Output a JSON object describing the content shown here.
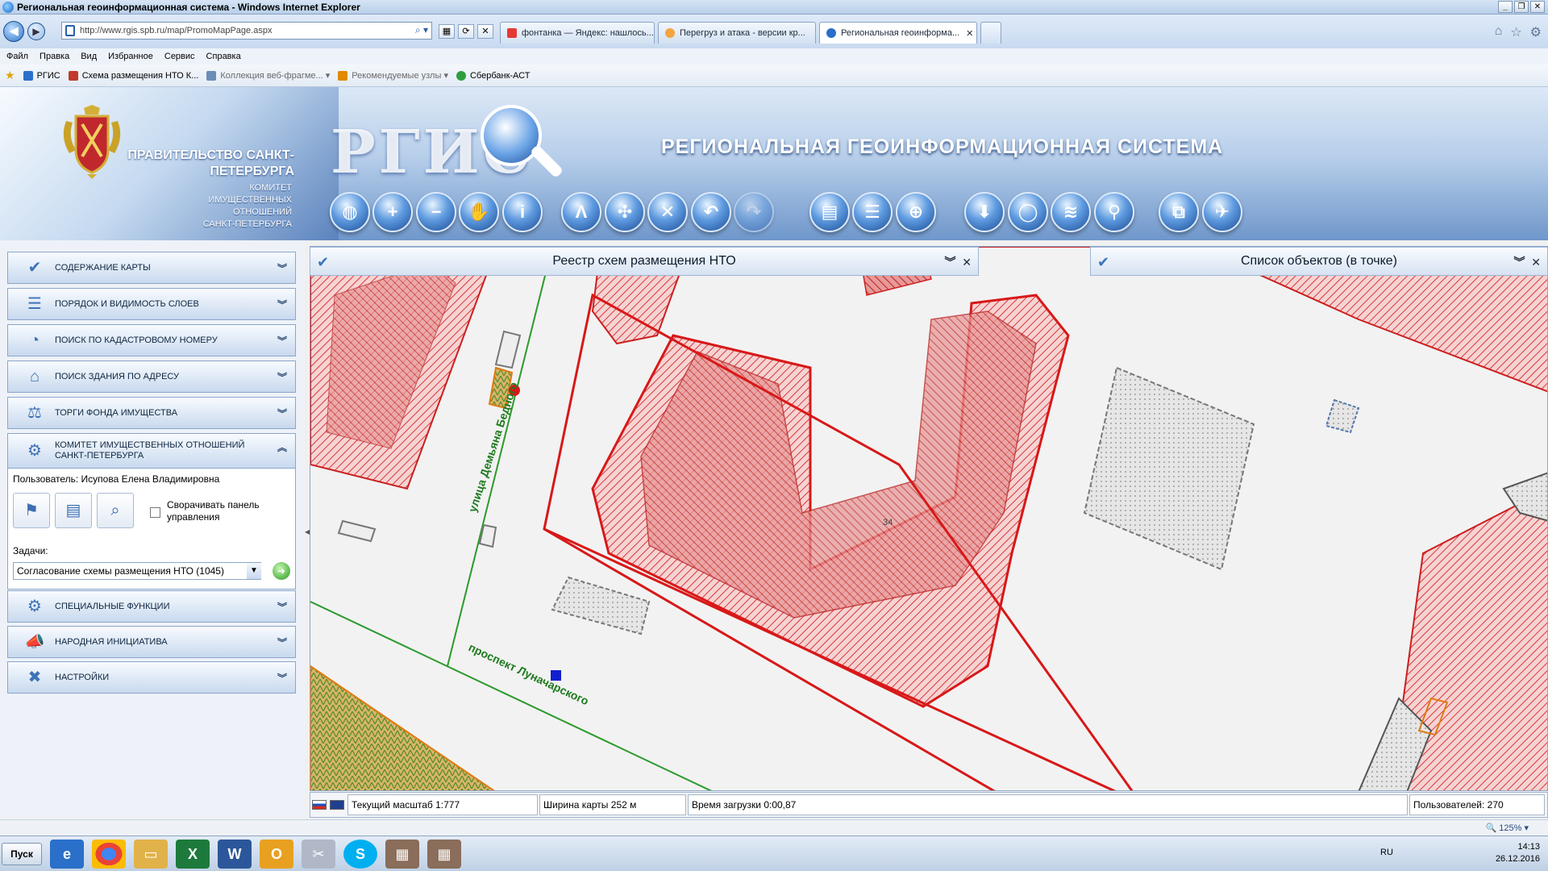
{
  "window": {
    "title": "Региональная геоинформационная система - Windows Internet Explorer"
  },
  "browser": {
    "address": "http://www.rgis.spb.ru/map/PromoMapPage.aspx",
    "tabs": [
      {
        "label": "фонтанка — Яндекс: нашлось..."
      },
      {
        "label": "Перегруз и атака - версии кр..."
      },
      {
        "label": "Региональная геоинформа..."
      }
    ],
    "close": "✕"
  },
  "menu": [
    "Файл",
    "Правка",
    "Вид",
    "Избранное",
    "Сервис",
    "Справка"
  ],
  "favorites": [
    {
      "label": "РГИС",
      "color": "#2a6fc9"
    },
    {
      "label": "Схема размещения НТО К...",
      "color": "#c0392b"
    },
    {
      "label": "Коллекция веб-фрагме...",
      "color": "#6b8db8"
    },
    {
      "label": "Рекомендуемые узлы",
      "color": "#e08a00"
    },
    {
      "label": "Сбербанк-АСТ",
      "color": "#2e9e3e"
    }
  ],
  "banner": {
    "gov_title": "ПРАВИТЕЛЬСТВО САНКТ-ПЕТЕРБУРГА",
    "committee_lines": [
      "КОМИТЕТ",
      "ИМУЩЕСТВЕННЫХ",
      "ОТНОШЕНИЙ",
      "САНКТ-ПЕТЕРБУРГА"
    ],
    "logo": "РГИС",
    "system_title": "РЕГИОНАЛЬНАЯ  ГЕОИНФОРМАЦИОННАЯ СИСТЕМА"
  },
  "toolbar": [
    {
      "name": "globe-tool",
      "glyph": "◍"
    },
    {
      "name": "zoom-in-tool",
      "glyph": "+"
    },
    {
      "name": "zoom-out-tool",
      "glyph": "−"
    },
    {
      "name": "pan-hand-tool",
      "glyph": "✋"
    },
    {
      "name": "info-tool",
      "glyph": "i"
    },
    {
      "name": "measure-tool",
      "glyph": "Λ"
    },
    {
      "name": "select-tool",
      "glyph": "✣"
    },
    {
      "name": "clear-tool",
      "glyph": "✕"
    },
    {
      "name": "undo-tool",
      "glyph": "↶"
    },
    {
      "name": "redo-tool",
      "glyph": "↷"
    },
    {
      "name": "print-tool",
      "glyph": "▤"
    },
    {
      "name": "list-tool",
      "glyph": "☰"
    },
    {
      "name": "web-tool",
      "glyph": "⊕"
    },
    {
      "name": "download-tool",
      "glyph": "⬇"
    },
    {
      "name": "comment-tool",
      "glyph": "◯"
    },
    {
      "name": "rss-tool",
      "glyph": "≋"
    },
    {
      "name": "location-tool",
      "glyph": "⚲"
    },
    {
      "name": "export-tool",
      "glyph": "⧉"
    },
    {
      "name": "fly-tool",
      "glyph": "✈"
    }
  ],
  "sidebar": {
    "items_top": [
      {
        "label": "СОДЕРЖАНИЕ КАРТЫ",
        "glyph": "✔"
      },
      {
        "label": "ПОРЯДОК И ВИДИМОСТЬ СЛОЕВ",
        "glyph": "☰"
      },
      {
        "label": "ПОИСК ПО КАДАСТРОВОМУ НОМЕРУ",
        "glyph": "◔"
      },
      {
        "label": "ПОИСК ЗДАНИЯ ПО АДРЕСУ",
        "glyph": "⌂"
      },
      {
        "label": "ТОРГИ ФОНДА ИМУЩЕСТВА",
        "glyph": "⚖"
      }
    ],
    "committee": {
      "label": "КОМИТЕТ ИМУЩЕСТВЕННЫХ ОТНОШЕНИЙ САНКТ-ПЕТЕРБУРГА",
      "user": "Пользователь: Исупова Елена Владимировна",
      "collapse_label": "Сворачивать панель управления",
      "tasks_label": "Задачи:",
      "task_value": "Согласование схемы размещения НТО (1045)"
    },
    "items_bottom": [
      {
        "label": "СПЕЦИАЛЬНЫЕ ФУНКЦИИ",
        "glyph": "⚙"
      },
      {
        "label": "НАРОДНАЯ ИНИЦИАТИВА",
        "glyph": "📣"
      },
      {
        "label": "НАСТРОЙКИ",
        "glyph": "✖"
      }
    ],
    "chev_down": "︾",
    "chev_up": "︽"
  },
  "map": {
    "panel_left": "Реестр схем размещения НТО",
    "panel_right": "Список объектов (в точке)",
    "street_1": "улица Демьяна Бедного",
    "street_2": "проспект Луначарского",
    "number_label": "34"
  },
  "status": {
    "scale": "Текущий масштаб 1:777",
    "width": "Ширина карты 252 м",
    "load": "Время загрузки 0:00,87",
    "users": "Пользователей: 270"
  },
  "browser_status": {
    "zoom": "125%"
  },
  "taskbar": {
    "start": "Пуск",
    "lang": "RU",
    "time": "14:13",
    "date": "26.12.2016"
  }
}
